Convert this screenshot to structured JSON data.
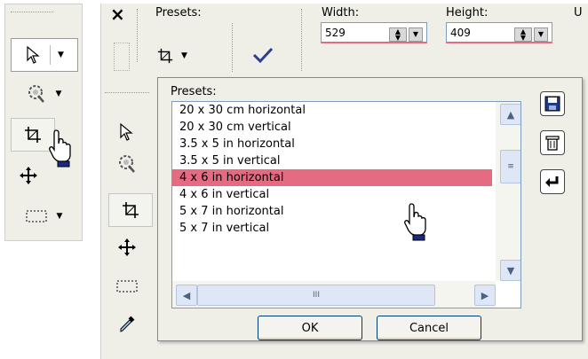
{
  "toolbar": {
    "close_icon": "×",
    "presets_label": "Presets:",
    "width_label": "Width:",
    "width_value": "529",
    "height_label": "Height:",
    "height_value": "409",
    "truncated_label": "U"
  },
  "popup": {
    "presets_title": "Presets:",
    "items": [
      "20 x 30 cm horizontal",
      "20 x 30 cm vertical",
      "3.5 x 5 in horizontal",
      "3.5 x 5 in vertical",
      "4 x 6 in horizontal",
      "4 x 6 in vertical",
      "5 x 7 in horizontal",
      "5 x 7 in vertical"
    ],
    "selected_index": 4,
    "ok_label": "OK",
    "cancel_label": "Cancel",
    "hscroll_thumb_text": "III"
  },
  "colors": {
    "selection": "#e56b82",
    "panel": "#efefe7",
    "list_border": "#7f9db9"
  },
  "icons": [
    "arrow-pointer-icon",
    "magic-wand-icon",
    "crop-icon",
    "move-icon",
    "rectangle-select-icon",
    "eyedropper-icon",
    "hand-cursor-icon",
    "save-icon",
    "delete-icon",
    "undo-icon",
    "checkmark-icon"
  ]
}
